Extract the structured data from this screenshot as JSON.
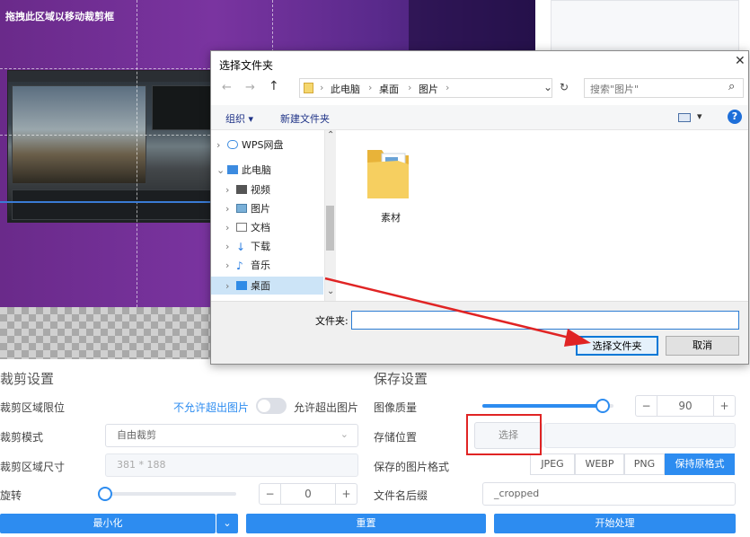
{
  "preview": {
    "drag_hint": "拖拽此区域以移动裁剪框"
  },
  "crop_settings": {
    "title": "裁剪设置",
    "limit_label": "裁剪区域限位",
    "limit_off": "不允许超出图片",
    "limit_on": "允许超出图片",
    "mode_label": "裁剪模式",
    "mode_value": "自由裁剪",
    "size_label": "裁剪区域尺寸",
    "size_value": "381 * 188",
    "rotate_label": "旋转",
    "rotate_value": "0",
    "rotate_minus": "−",
    "rotate_plus": "+"
  },
  "save_settings": {
    "title": "保存设置",
    "quality_label": "图像质量",
    "quality_value": "90",
    "quality_minus": "−",
    "quality_plus": "+",
    "location_label": "存储位置",
    "choose_button": "选择",
    "format_label": "保存的图片格式",
    "formats": [
      "JPEG",
      "WEBP",
      "PNG",
      "保持原格式"
    ],
    "suffix_label": "文件名后缀",
    "suffix_value": "_cropped",
    "quality_fraction": 0.92
  },
  "bottom_bar": {
    "minimize": "最小化",
    "dropdown": "⌄",
    "reset": "重置",
    "start": "开始处理"
  },
  "dialog": {
    "title": "选择文件夹",
    "close": "✕",
    "back": "←",
    "forward": "→",
    "up": "↑",
    "path": [
      "此电脑",
      "桌面",
      "图片"
    ],
    "path_sep": "›",
    "refresh": "↻",
    "dropdown": "⌄",
    "search_placeholder": "搜索\"图片\"",
    "search_icon": "⌕",
    "toolbar_organize": "组织",
    "toolbar_new_folder": "新建文件夹",
    "view_arrow": "▾",
    "help": "?",
    "tree": [
      {
        "label": "WPS网盘",
        "chev": "›"
      },
      {
        "label": "此电脑",
        "chev": "⌄"
      },
      {
        "label": "视频",
        "chev": "›"
      },
      {
        "label": "图片",
        "chev": "›"
      },
      {
        "label": "文档",
        "chev": "›"
      },
      {
        "label": "下载",
        "chev": "›"
      },
      {
        "label": "音乐",
        "chev": "›"
      },
      {
        "label": "桌面",
        "chev": "›"
      }
    ],
    "scroll_up": "⌃",
    "scroll_down": "⌄",
    "folder_item": "素材",
    "folder_label": "文件夹:",
    "folder_value": "",
    "select_button": "选择文件夹",
    "cancel_button": "取消"
  },
  "colors": {
    "accent": "#2d8cf0",
    "annotation": "#e02424"
  }
}
